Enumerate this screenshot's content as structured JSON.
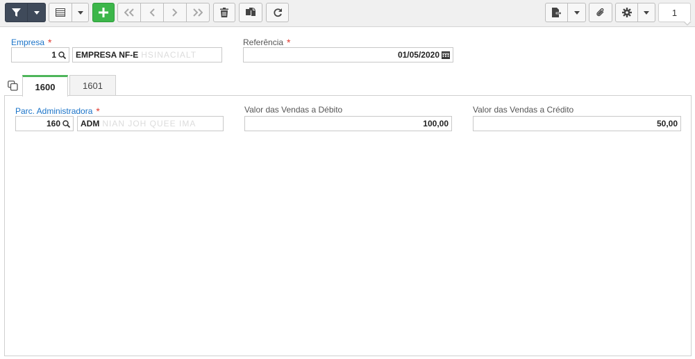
{
  "toolbar": {
    "buttons": [
      {
        "name": "filter-button",
        "icon": "filter-icon"
      },
      {
        "name": "filter-dropdown",
        "icon": "caret-down-icon"
      },
      {
        "name": "grid-view-button",
        "icon": "list-icon"
      },
      {
        "name": "view-dropdown",
        "icon": "caret-down-icon"
      },
      {
        "name": "add-button",
        "icon": "plus-icon"
      },
      {
        "name": "first-record-button",
        "icon": "double-chevron-left-icon"
      },
      {
        "name": "previous-record-button",
        "icon": "chevron-left-icon"
      },
      {
        "name": "next-record-button",
        "icon": "chevron-right-icon"
      },
      {
        "name": "last-record-button",
        "icon": "double-chevron-right-icon"
      },
      {
        "name": "delete-button",
        "icon": "trash-icon"
      },
      {
        "name": "copy-button",
        "icon": "copy-icon"
      },
      {
        "name": "refresh-button",
        "icon": "refresh-icon"
      },
      {
        "name": "export-button",
        "icon": "file-export-icon"
      },
      {
        "name": "export-dropdown",
        "icon": "caret-down-icon"
      },
      {
        "name": "attachment-button",
        "icon": "paperclip-icon"
      },
      {
        "name": "settings-button",
        "icon": "gear-icon"
      },
      {
        "name": "settings-dropdown",
        "icon": "caret-down-icon"
      }
    ],
    "record_counter": "1",
    "accent_colors": {
      "dark": "#3f4a5a",
      "green": "#3cb64a"
    }
  },
  "header": {
    "empresa_label": "Empresa",
    "empresa_required": "*",
    "empresa_code": "1",
    "empresa_name": "EMPRESA NF-E",
    "empresa_name_blurred": "HSINACIALT",
    "referencia_label": "Referência",
    "referencia_required": "*",
    "referencia_value": "01/05/2020"
  },
  "tabs": [
    {
      "label": "1600",
      "active": true
    },
    {
      "label": "1601",
      "active": false
    }
  ],
  "panel": {
    "parc_label": "Parc. Administradora",
    "parc_required": "*",
    "parc_code": "160",
    "parc_name": "ADM",
    "parc_name_blurred": "NIAN JOH QUEE IMA",
    "debito_label": "Valor das Vendas a Débito",
    "debito_value": "100,00",
    "credito_label": "Valor das Vendas a Crédito",
    "credito_value": "50,00"
  }
}
